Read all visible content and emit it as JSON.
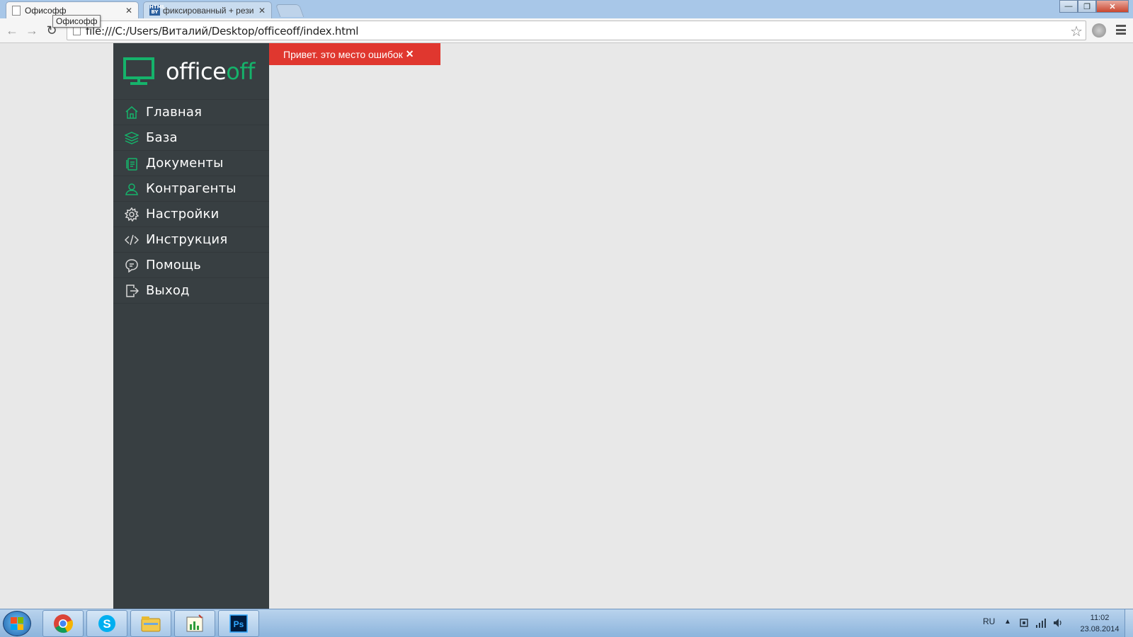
{
  "browser": {
    "tabs": [
      {
        "title": "Офисофф",
        "active": true
      },
      {
        "title": "фиксированный + резин",
        "active": false
      }
    ],
    "tooltip": "Офисофф",
    "window_controls": {
      "minimize": "—",
      "restore": "❐",
      "close": "✕"
    },
    "url": "file:///C:/Users/Виталий/Desktop/officeoff/index.html"
  },
  "app": {
    "logo": {
      "part1": "office",
      "part2": "off"
    },
    "accent_color": "#15b36b",
    "sidebar_color": "#383f42",
    "nav": [
      {
        "label": "Главная",
        "icon": "home-icon"
      },
      {
        "label": "База",
        "icon": "layers-icon"
      },
      {
        "label": "Документы",
        "icon": "documents-icon"
      },
      {
        "label": "Контрагенты",
        "icon": "user-icon"
      },
      {
        "label": "Настройки",
        "icon": "gear-icon"
      },
      {
        "label": "Инструкция",
        "icon": "code-icon"
      },
      {
        "label": "Помощь",
        "icon": "chat-icon"
      },
      {
        "label": "Выход",
        "icon": "logout-icon"
      }
    ],
    "error": {
      "message": "Привет. это место ошибок",
      "close": "✕",
      "color": "#e0372f"
    }
  },
  "taskbar": {
    "apps": [
      "chrome-icon",
      "skype-icon",
      "explorer-icon",
      "charts-icon",
      "photoshop-icon"
    ],
    "language": "RU",
    "time": "11:02",
    "date": "23.08.2014"
  }
}
